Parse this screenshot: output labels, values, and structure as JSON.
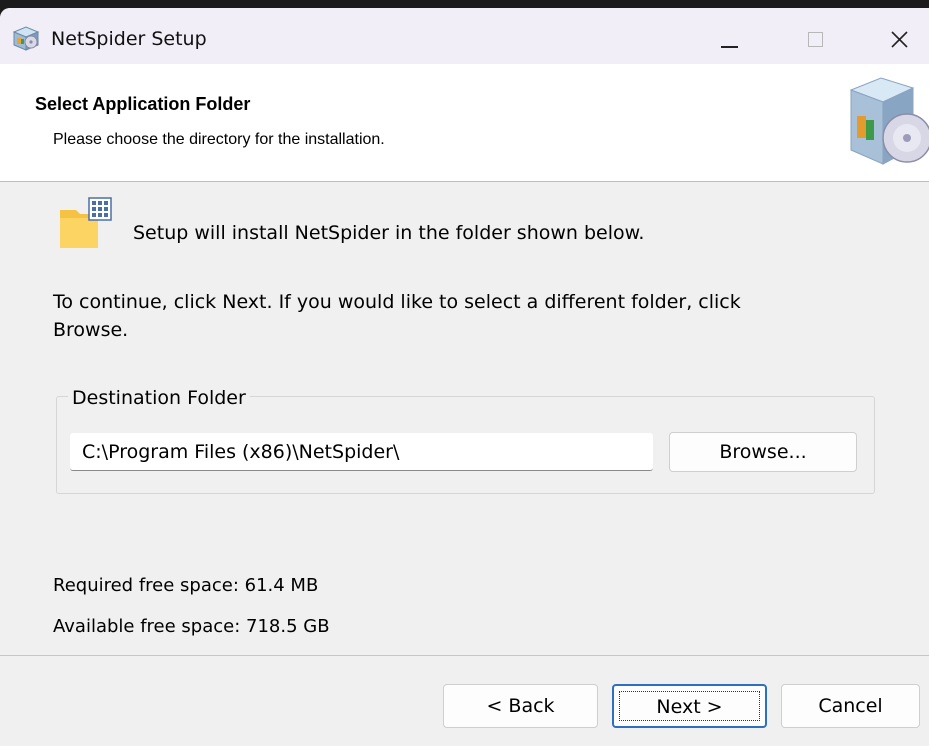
{
  "window": {
    "title": "NetSpider Setup",
    "controls": {
      "minimize": "minimize",
      "maximize": "maximize",
      "close": "close"
    }
  },
  "header": {
    "title": "Select Application Folder",
    "subtitle": "Please choose the directory for the installation."
  },
  "body": {
    "intro": "Setup will install NetSpider in the folder shown below.",
    "instruction": "To continue, click Next. If you would like to select a different folder, click Browse."
  },
  "destination": {
    "group_label": "Destination Folder",
    "path_value": "C:\\Program Files (x86)\\NetSpider\\",
    "browse_label": "Browse..."
  },
  "space": {
    "required": "Required free space: 61.4 MB",
    "available": "Available free space: 718.5 GB"
  },
  "buttons": {
    "back": "< Back",
    "next": "Next >",
    "cancel": "Cancel"
  },
  "icons": {
    "app": "installer-box-icon",
    "header": "installer-box-cd-icon",
    "folder": "folder-icon"
  },
  "colors": {
    "titlebar_bg": "#f2eef8",
    "header_bg": "#ffffff",
    "dialog_bg": "#f0f0f0",
    "focus_border": "#2f6fc2"
  }
}
